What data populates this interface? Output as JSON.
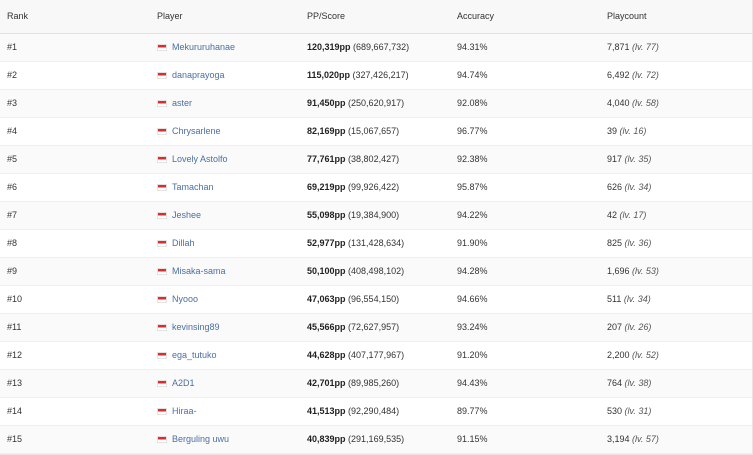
{
  "headers": {
    "rank": "Rank",
    "player": "Player",
    "pp_score": "PP/Score",
    "accuracy": "Accuracy",
    "playcount": "Playcount"
  },
  "flag_icon": "indonesia-flag-icon",
  "colors": {
    "link": "#4a6fa5",
    "flag_red": "#e12a2a"
  },
  "rows": [
    {
      "rank": "#1",
      "player": "Mekururuhanae",
      "pp": "120,319pp",
      "score": "(689,667,732)",
      "accuracy": "94.31%",
      "playcount": "7,871",
      "level": "(lv. 77)"
    },
    {
      "rank": "#2",
      "player": "danaprayoga",
      "pp": "115,020pp",
      "score": "(327,426,217)",
      "accuracy": "94.74%",
      "playcount": "6,492",
      "level": "(lv. 72)"
    },
    {
      "rank": "#3",
      "player": "aster",
      "pp": "91,450pp",
      "score": "(250,620,917)",
      "accuracy": "92.08%",
      "playcount": "4,040",
      "level": "(lv. 58)"
    },
    {
      "rank": "#4",
      "player": "Chrysarlene",
      "pp": "82,169pp",
      "score": "(15,067,657)",
      "accuracy": "96.77%",
      "playcount": "39",
      "level": "(lv. 16)"
    },
    {
      "rank": "#5",
      "player": "Lovely Astolfo",
      "pp": "77,761pp",
      "score": "(38,802,427)",
      "accuracy": "92.38%",
      "playcount": "917",
      "level": "(lv. 35)"
    },
    {
      "rank": "#6",
      "player": "Tamachan",
      "pp": "69,219pp",
      "score": "(99,926,422)",
      "accuracy": "95.87%",
      "playcount": "626",
      "level": "(lv. 34)"
    },
    {
      "rank": "#7",
      "player": "Jeshee",
      "pp": "55,098pp",
      "score": "(19,384,900)",
      "accuracy": "94.22%",
      "playcount": "42",
      "level": "(lv. 17)"
    },
    {
      "rank": "#8",
      "player": "Dillah",
      "pp": "52,977pp",
      "score": "(131,428,634)",
      "accuracy": "91.90%",
      "playcount": "825",
      "level": "(lv. 36)"
    },
    {
      "rank": "#9",
      "player": "Misaka-sama",
      "pp": "50,100pp",
      "score": "(408,498,102)",
      "accuracy": "94.28%",
      "playcount": "1,696",
      "level": "(lv. 53)"
    },
    {
      "rank": "#10",
      "player": "Nyooo",
      "pp": "47,063pp",
      "score": "(96,554,150)",
      "accuracy": "94.66%",
      "playcount": "511",
      "level": "(lv. 34)"
    },
    {
      "rank": "#11",
      "player": "kevinsing89",
      "pp": "45,566pp",
      "score": "(72,627,957)",
      "accuracy": "93.24%",
      "playcount": "207",
      "level": "(lv. 26)"
    },
    {
      "rank": "#12",
      "player": "ega_tutuko",
      "pp": "44,628pp",
      "score": "(407,177,967)",
      "accuracy": "91.20%",
      "playcount": "2,200",
      "level": "(lv. 52)"
    },
    {
      "rank": "#13",
      "player": "A2D1",
      "pp": "42,701pp",
      "score": "(89,985,260)",
      "accuracy": "94.43%",
      "playcount": "764",
      "level": "(lv. 38)"
    },
    {
      "rank": "#14",
      "player": "Hiraa-",
      "pp": "41,513pp",
      "score": "(92,290,484)",
      "accuracy": "89.77%",
      "playcount": "530",
      "level": "(lv. 31)"
    },
    {
      "rank": "#15",
      "player": "Berguling uwu",
      "pp": "40,839pp",
      "score": "(291,169,535)",
      "accuracy": "91.15%",
      "playcount": "3,194",
      "level": "(lv. 57)"
    }
  ]
}
